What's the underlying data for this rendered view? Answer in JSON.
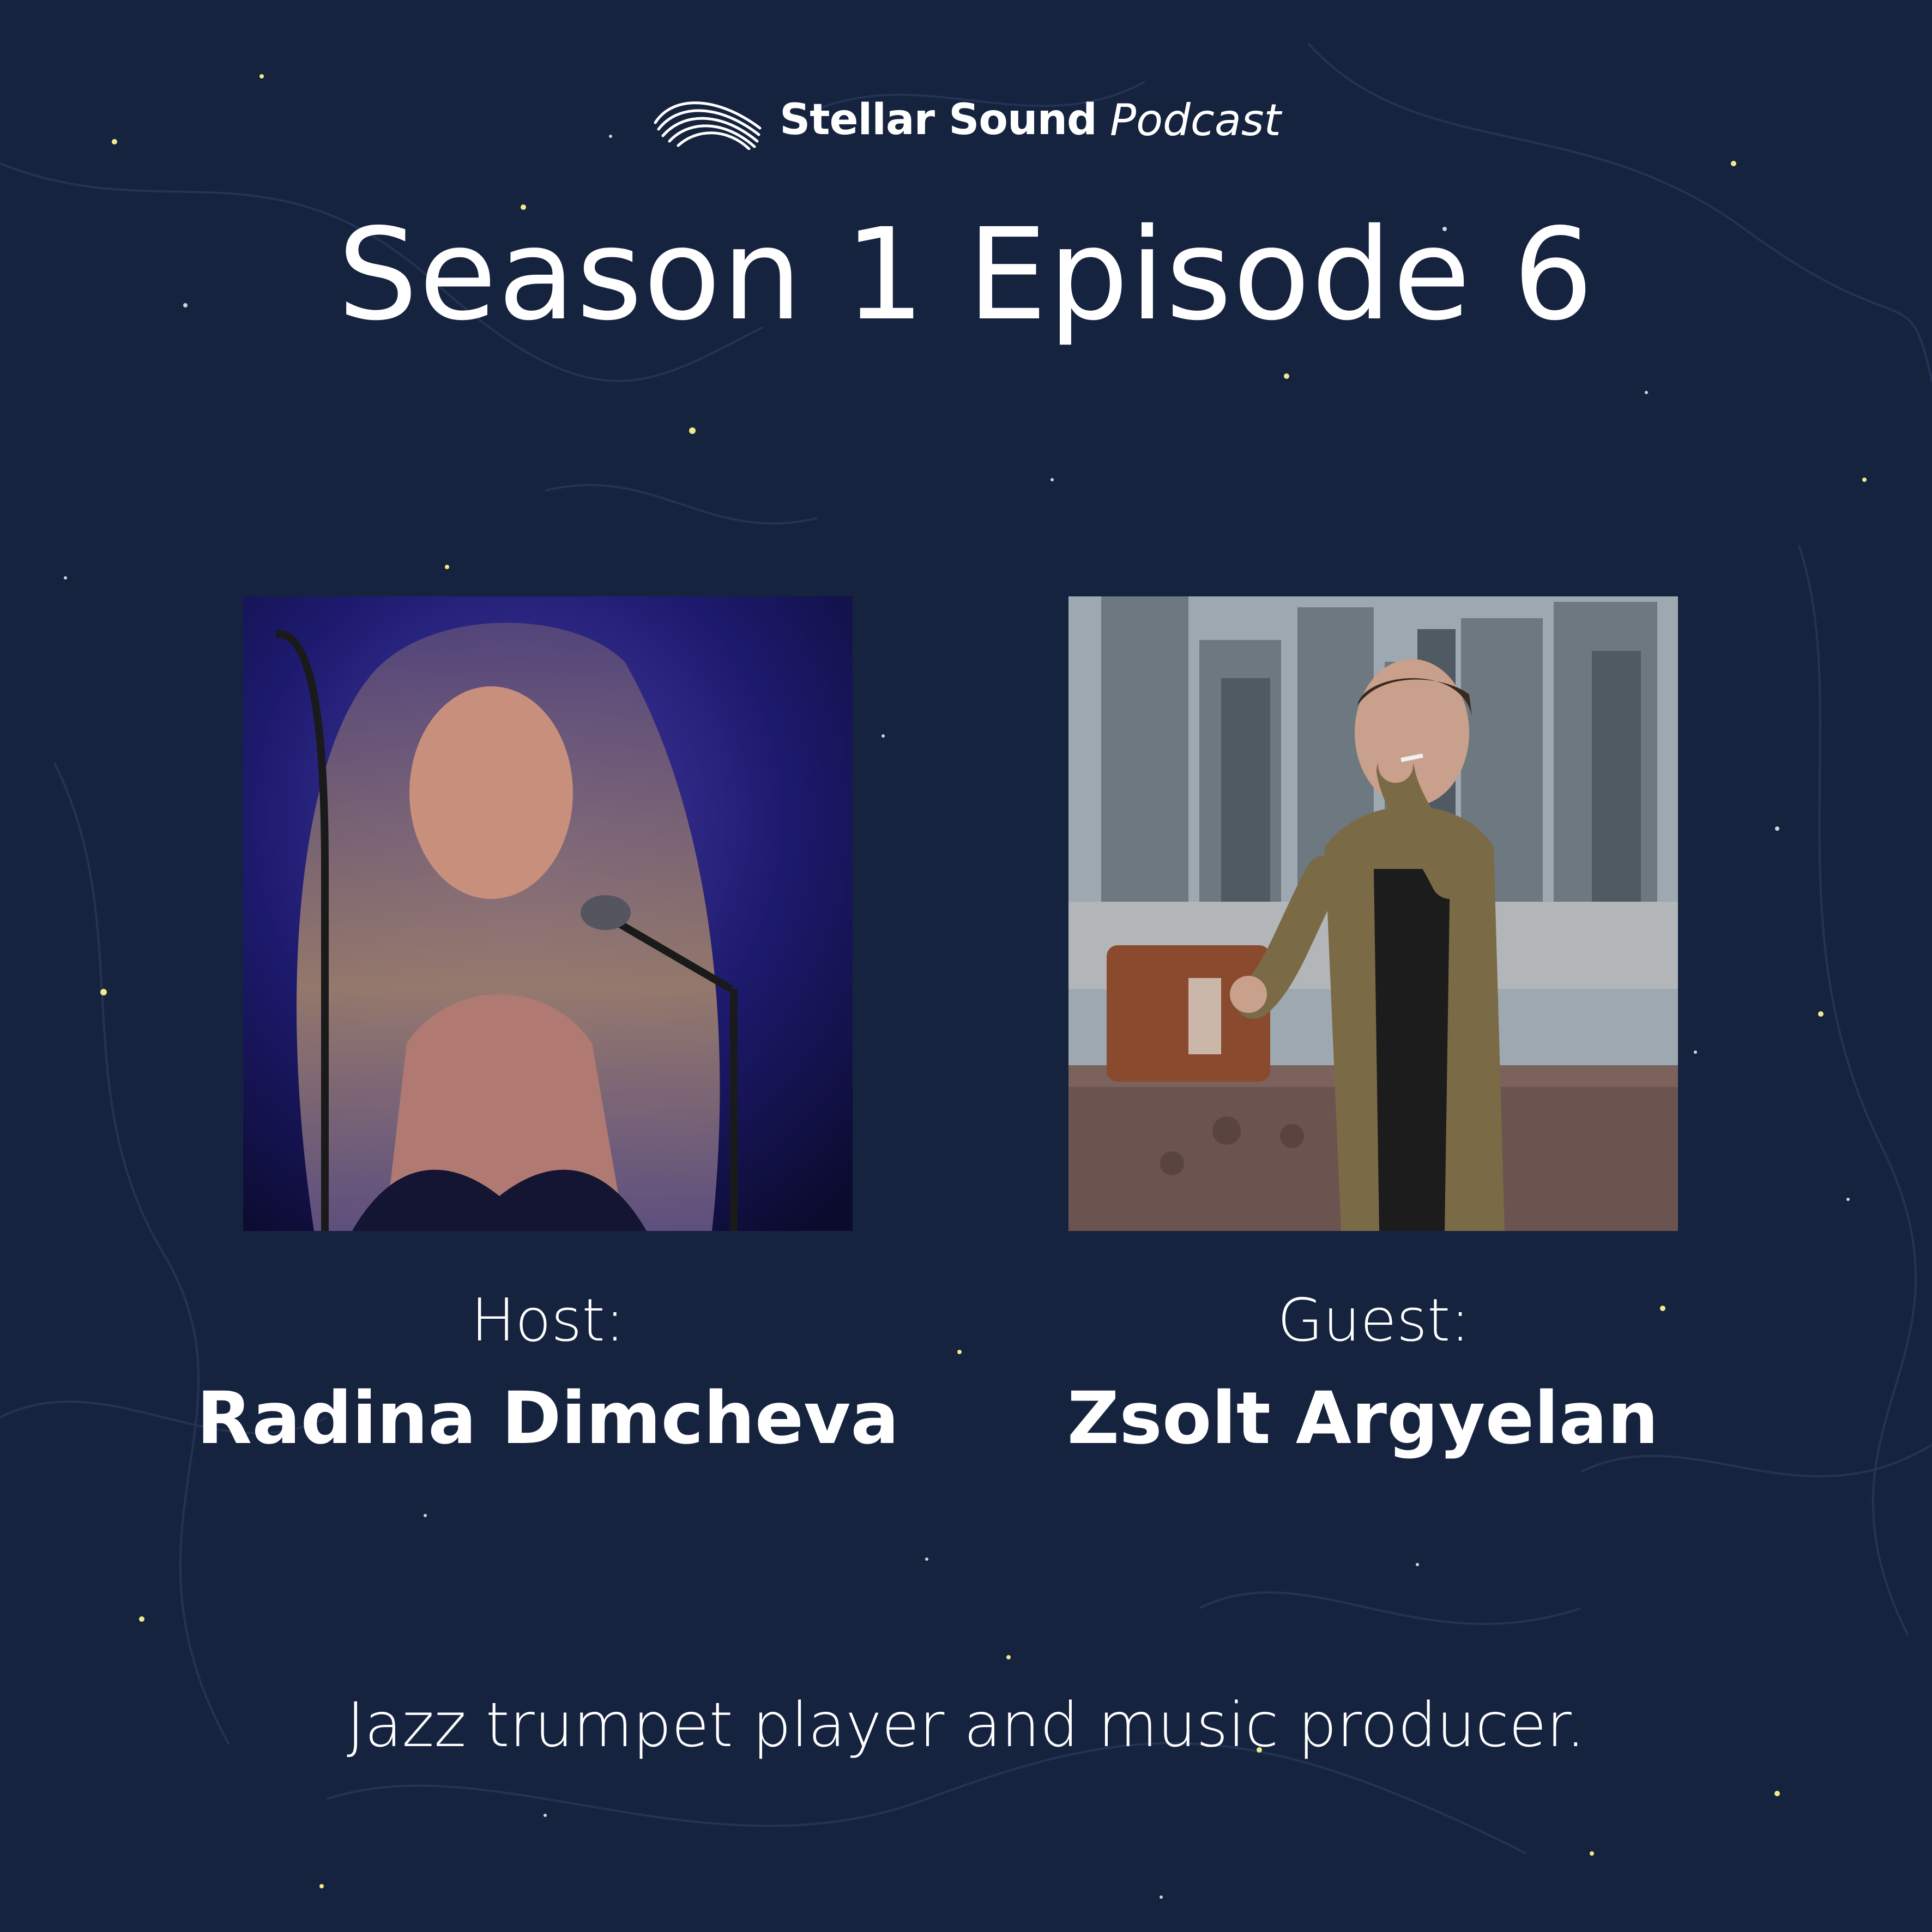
{
  "brand": {
    "name": "Stellar Sound",
    "subtitle": "Podcast"
  },
  "episode": {
    "title": "Season 1 Episode 6"
  },
  "host": {
    "role": "Host:",
    "name": "Radina Dimcheva"
  },
  "guest": {
    "role": "Guest:",
    "name": "Zsolt Argyelan"
  },
  "description": "Jazz trumpet player and music producer.",
  "colors": {
    "background": "#16233f",
    "text": "#ffffff",
    "star": "#f2e98a"
  }
}
